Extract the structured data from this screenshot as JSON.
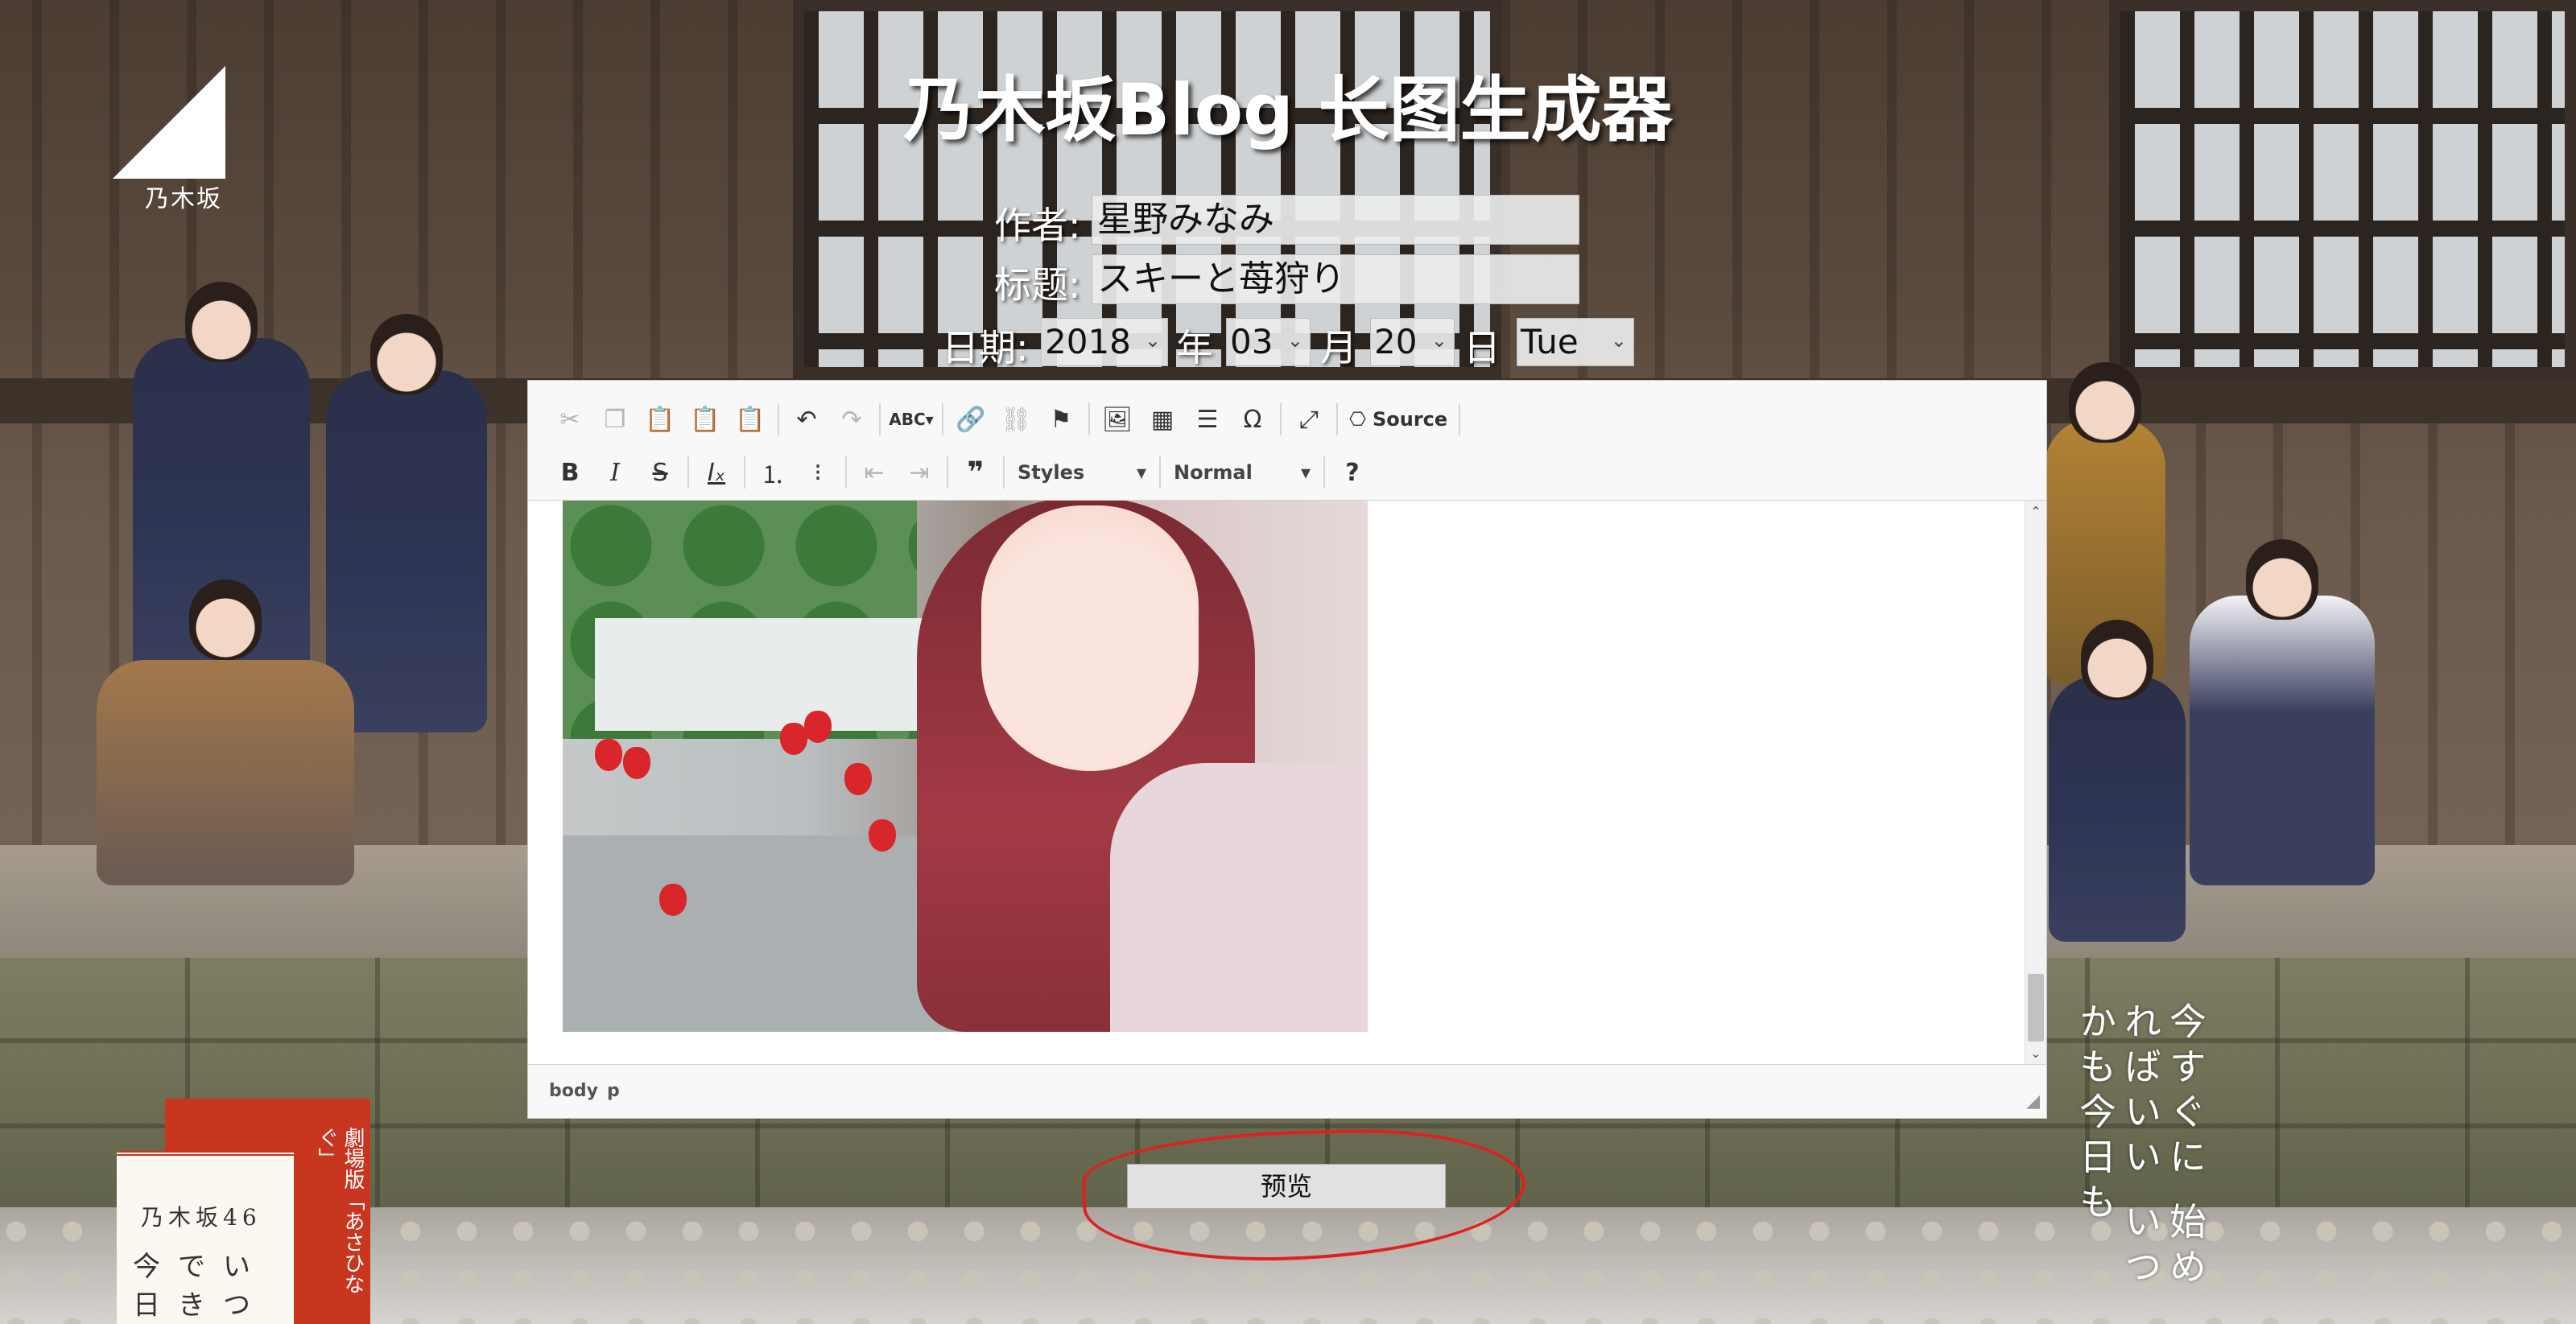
{
  "page": {
    "title": "乃木坂Blog 长图生成器",
    "author_label": "作者:",
    "author_value": "星野みなみ",
    "title_label": "标题:",
    "title_value": "スキーと苺狩り",
    "date_label": "日期:",
    "year": "2018",
    "year_suffix": "年",
    "month": "03",
    "month_suffix": "月",
    "day": "20",
    "day_suffix": "日",
    "weekday": "Tue",
    "preview_button": "预览"
  },
  "background": {
    "logo_number": "46",
    "logo_name": "乃木坂",
    "poster_red_text": "劇場版「あさひなぐ」",
    "poster_card_title": "乃木坂46",
    "poster_card_lines": [
      "今でい",
      "日きつ"
    ],
    "poem_text": "今すぐに 始めればいい いつかも今日も"
  },
  "editor": {
    "toolbar_row1": [
      "cut-icon",
      "copy-icon",
      "paste-icon",
      "paste-text-icon",
      "paste-word-icon",
      "undo-icon",
      "redo-icon",
      "spellcheck-icon",
      "link-icon",
      "unlink-icon",
      "anchor-icon",
      "image-icon",
      "table-icon",
      "horizontal-rule-icon",
      "special-char-icon",
      "maximize-icon",
      "source-icon"
    ],
    "source_label": "Source",
    "toolbar_row2": [
      "bold-icon",
      "italic-icon",
      "strike-icon",
      "remove-format-icon",
      "numbered-list-icon",
      "bulleted-list-icon",
      "outdent-icon",
      "indent-icon",
      "blockquote-icon"
    ],
    "styles_combo": "Styles",
    "format_combo": "Normal",
    "help_label": "?",
    "path": [
      "body",
      "p"
    ]
  },
  "colors": {
    "title_text": "#ffffff",
    "annotation": "#e21f1f",
    "toolbar_bg": "#f8f8f8"
  }
}
